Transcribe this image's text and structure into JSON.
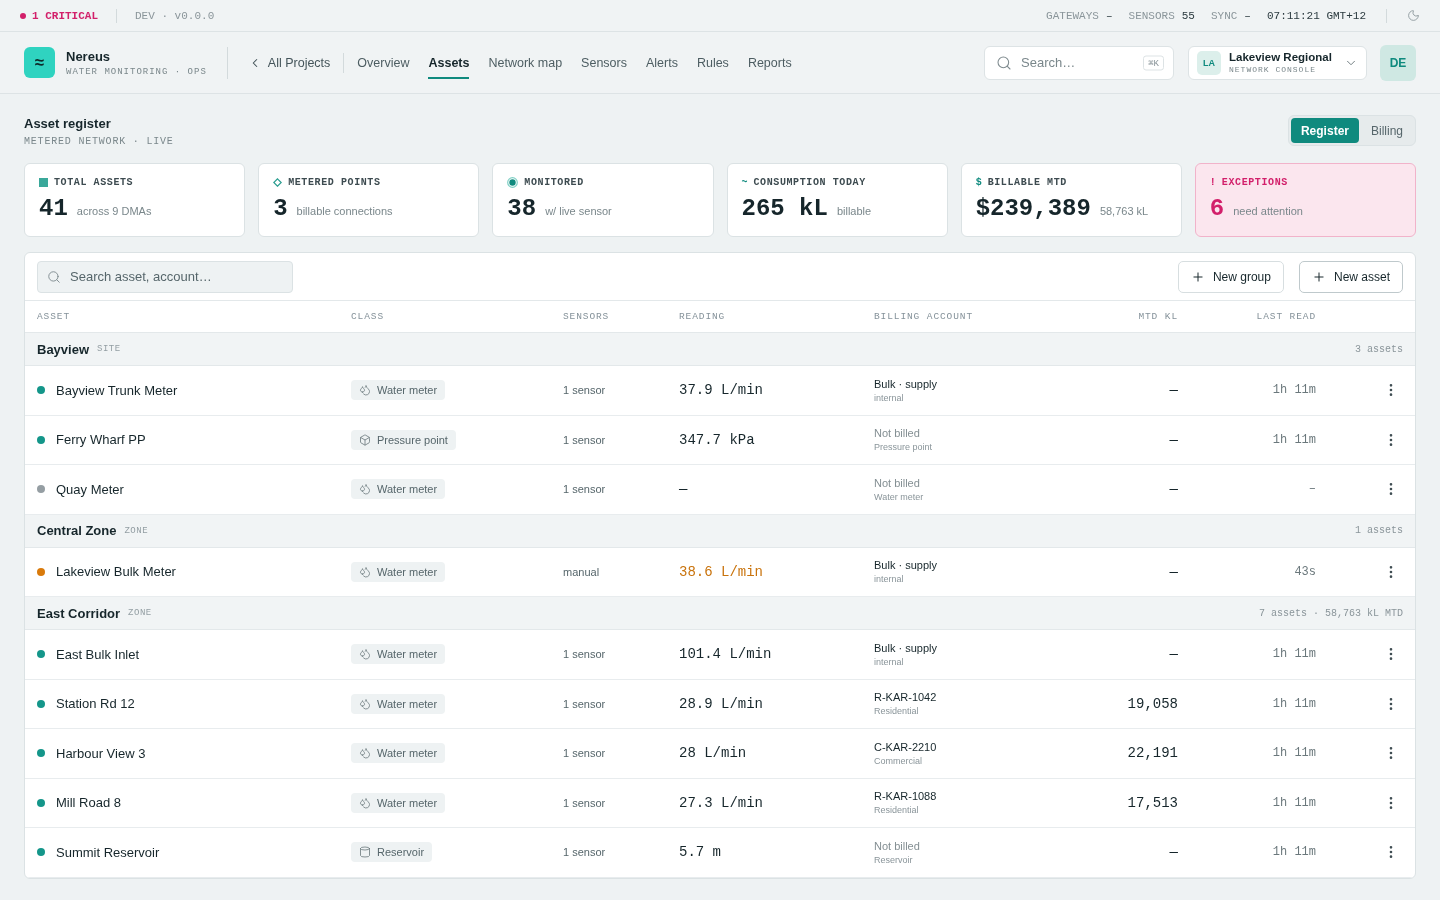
{
  "status_bar": {
    "critical": "1 CRITICAL",
    "env": "DEV · v0.0.0",
    "metrics": [
      {
        "label": "GATEWAYS",
        "value": "–"
      },
      {
        "label": "SENSORS",
        "value": "55"
      },
      {
        "label": "SYNC",
        "value": "–"
      }
    ],
    "time": "07:11:21 GMT+12"
  },
  "header": {
    "brand": {
      "logo_mark": "≈",
      "name": "Nereus",
      "subtitle": "WATER MONITORING · OPS"
    },
    "back_link": "All Projects",
    "tabs": [
      {
        "label": "Overview",
        "selected": false
      },
      {
        "label": "Assets",
        "selected": true
      },
      {
        "label": "Network map",
        "selected": false
      },
      {
        "label": "Sensors",
        "selected": false
      },
      {
        "label": "Alerts",
        "selected": false
      },
      {
        "label": "Rules",
        "selected": false
      },
      {
        "label": "Reports",
        "selected": false
      }
    ],
    "search": {
      "placeholder": "Search…",
      "shortcut": "⌘K"
    },
    "project": {
      "initials": "LA",
      "name": "Lakeview Regional",
      "subtitle": "NETWORK CONSOLE"
    },
    "avatar": "DE"
  },
  "page": {
    "title": "Asset register",
    "subtitle": "METERED NETWORK · LIVE",
    "view_toggle": [
      {
        "label": "Register",
        "selected": true
      },
      {
        "label": "Billing",
        "selected": false
      }
    ]
  },
  "stats": [
    {
      "kind": "total",
      "label": "TOTAL ASSETS",
      "value": "41",
      "note": "across 9 DMAs",
      "alert": false
    },
    {
      "kind": "points",
      "label": "METERED POINTS",
      "value": "3",
      "note": "billable connections",
      "alert": false
    },
    {
      "kind": "monitored",
      "label": "MONITORED",
      "value": "38",
      "note": "w/ live sensor",
      "alert": false
    },
    {
      "kind": "marker",
      "marker": "~",
      "label": "CONSUMPTION TODAY",
      "value": "265 kL",
      "note": "billable",
      "alert": false
    },
    {
      "kind": "marker",
      "marker": "$",
      "label": "BILLABLE MTD",
      "value": "$239,389",
      "note": "58,763 kL",
      "alert": false
    },
    {
      "kind": "marker",
      "marker": "!",
      "label": "EXCEPTIONS",
      "value": "6",
      "note": "need attention",
      "alert": true
    }
  ],
  "table": {
    "search": {
      "placeholder": "Search asset, account…"
    },
    "actions": [
      "New group",
      "New asset"
    ],
    "columns": [
      "ASSET",
      "CLASS",
      "SENSORS",
      "READING",
      "BILLING ACCOUNT",
      "MTD KL",
      "LAST READ"
    ],
    "groups": [
      {
        "name": "Bayview",
        "type": "SITE",
        "summary": "3 assets",
        "rows": [
          {
            "name": "Bayview Trunk Meter",
            "color": "#14968a",
            "class": {
              "kind": "water_meter",
              "label": "Water meter"
            },
            "sensors": "1 sensor",
            "reading": "37.9 L/min",
            "flagged": false,
            "billing": "Bulk · supply",
            "billing_note": "internal",
            "billed": true,
            "mtd": "—",
            "last_read": "1h 11m"
          },
          {
            "name": "Ferry Wharf PP",
            "color": "#14968a",
            "class": {
              "kind": "pressure_point",
              "label": "Pressure point"
            },
            "sensors": "1 sensor",
            "reading": "347.7 kPa",
            "flagged": false,
            "billing": "Not billed",
            "billing_note": "Pressure point",
            "billed": false,
            "mtd": "—",
            "last_read": "1h 11m"
          },
          {
            "name": "Quay Meter",
            "color": "#959ea3",
            "class": {
              "kind": "water_meter",
              "label": "Water meter"
            },
            "sensors": "1 sensor",
            "reading": "—",
            "flagged": false,
            "billing": "Not billed",
            "billing_note": "Water meter",
            "billed": false,
            "mtd": "—",
            "last_read": "–"
          }
        ]
      },
      {
        "name": "Central Zone",
        "type": "ZONE",
        "summary": "1 assets",
        "rows": [
          {
            "name": "Lakeview Bulk Meter",
            "color": "#d97a0b",
            "class": {
              "kind": "water_meter",
              "label": "Water meter"
            },
            "sensors": "manual",
            "reading": "38.6 L/min",
            "flagged": true,
            "billing": "Bulk · supply",
            "billing_note": "internal",
            "billed": true,
            "mtd": "—",
            "last_read": "43s"
          }
        ]
      },
      {
        "name": "East Corridor",
        "type": "ZONE",
        "summary": "7 assets · 58,763 kL MTD",
        "rows": [
          {
            "name": "East Bulk Inlet",
            "color": "#14968a",
            "class": {
              "kind": "water_meter",
              "label": "Water meter"
            },
            "sensors": "1 sensor",
            "reading": "101.4 L/min",
            "flagged": false,
            "billing": "Bulk · supply",
            "billing_note": "internal",
            "billed": true,
            "mtd": "—",
            "last_read": "1h 11m"
          },
          {
            "name": "Station Rd 12",
            "color": "#14968a",
            "class": {
              "kind": "water_meter",
              "label": "Water meter"
            },
            "sensors": "1 sensor",
            "reading": "28.9 L/min",
            "flagged": false,
            "billing": "R-KAR-1042",
            "billing_note": "Residential",
            "billed": true,
            "mtd": "19,058",
            "last_read": "1h 11m"
          },
          {
            "name": "Harbour View 3",
            "color": "#14968a",
            "class": {
              "kind": "water_meter",
              "label": "Water meter"
            },
            "sensors": "1 sensor",
            "reading": "28 L/min",
            "flagged": false,
            "billing": "C-KAR-2210",
            "billing_note": "Commercial",
            "billed": true,
            "mtd": "22,191",
            "last_read": "1h 11m"
          },
          {
            "name": "Mill Road 8",
            "color": "#14968a",
            "class": {
              "kind": "water_meter",
              "label": "Water meter"
            },
            "sensors": "1 sensor",
            "reading": "27.3 L/min",
            "flagged": false,
            "billing": "R-KAR-1088",
            "billing_note": "Residential",
            "billed": true,
            "mtd": "17,513",
            "last_read": "1h 11m"
          },
          {
            "name": "Summit Reservoir",
            "color": "#14968a",
            "class": {
              "kind": "reservoir",
              "label": "Reservoir"
            },
            "sensors": "1 sensor",
            "reading": "5.7 m",
            "flagged": false,
            "billing": "Not billed",
            "billing_note": "Reservoir",
            "billed": false,
            "mtd": "—",
            "last_read": "1h 11m"
          }
        ]
      }
    ]
  }
}
